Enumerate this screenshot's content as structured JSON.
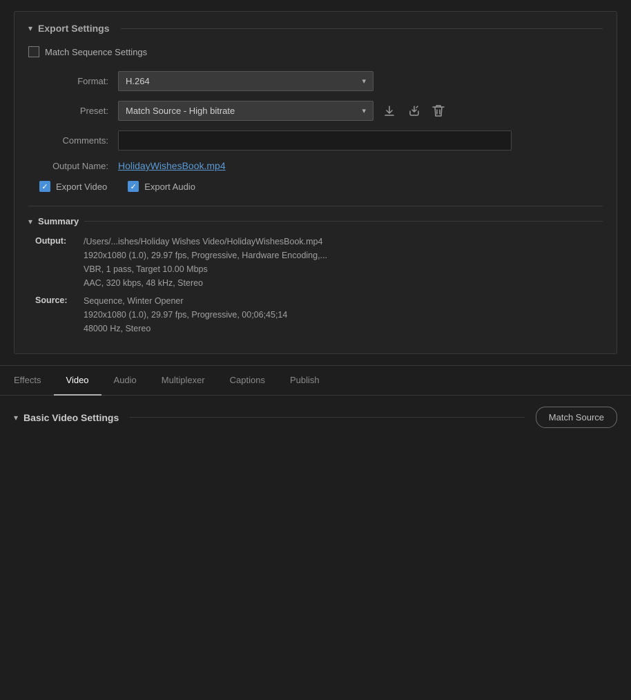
{
  "exportSettings": {
    "title": "Export Settings",
    "matchSequenceLabel": "Match Sequence Settings",
    "formatLabel": "Format:",
    "formatValue": "H.264",
    "presetLabel": "Preset:",
    "presetValue": "Match Source - High bitrate",
    "commentsLabel": "Comments:",
    "commentsPlaceholder": "",
    "outputNameLabel": "Output Name:",
    "outputNameValue": "HolidayWishesBook.mp4",
    "exportVideoLabel": "Export Video",
    "exportAudioLabel": "Export Audio"
  },
  "summary": {
    "title": "Summary",
    "outputLabel": "Output:",
    "outputPath": "/Users/...ishes/Holiday Wishes Video/HolidayWishesBook.mp4",
    "outputLine2": "1920x1080 (1.0), 29.97 fps, Progressive, Hardware Encoding,...",
    "outputLine3": "VBR, 1 pass, Target 10.00 Mbps",
    "outputLine4": "AAC, 320 kbps, 48 kHz, Stereo",
    "sourceLabel": "Source:",
    "sourceLine1": "Sequence, Winter Opener",
    "sourceLine2": "1920x1080 (1.0), 29.97 fps, Progressive, 00;06;45;14",
    "sourceLine3": "48000 Hz, Stereo"
  },
  "tabs": [
    {
      "id": "effects",
      "label": "Effects",
      "active": false
    },
    {
      "id": "video",
      "label": "Video",
      "active": true
    },
    {
      "id": "audio",
      "label": "Audio",
      "active": false
    },
    {
      "id": "multiplexer",
      "label": "Multiplexer",
      "active": false
    },
    {
      "id": "captions",
      "label": "Captions",
      "active": false
    },
    {
      "id": "publish",
      "label": "Publish",
      "active": false
    }
  ],
  "videoSettings": {
    "title": "Basic Video Settings",
    "matchSourceBtn": "Match Source"
  },
  "icons": {
    "chevronDown": "▾",
    "checkmark": "✓",
    "savePreset": "⬇",
    "importPreset": "⤴",
    "deletePreset": "🗑"
  }
}
